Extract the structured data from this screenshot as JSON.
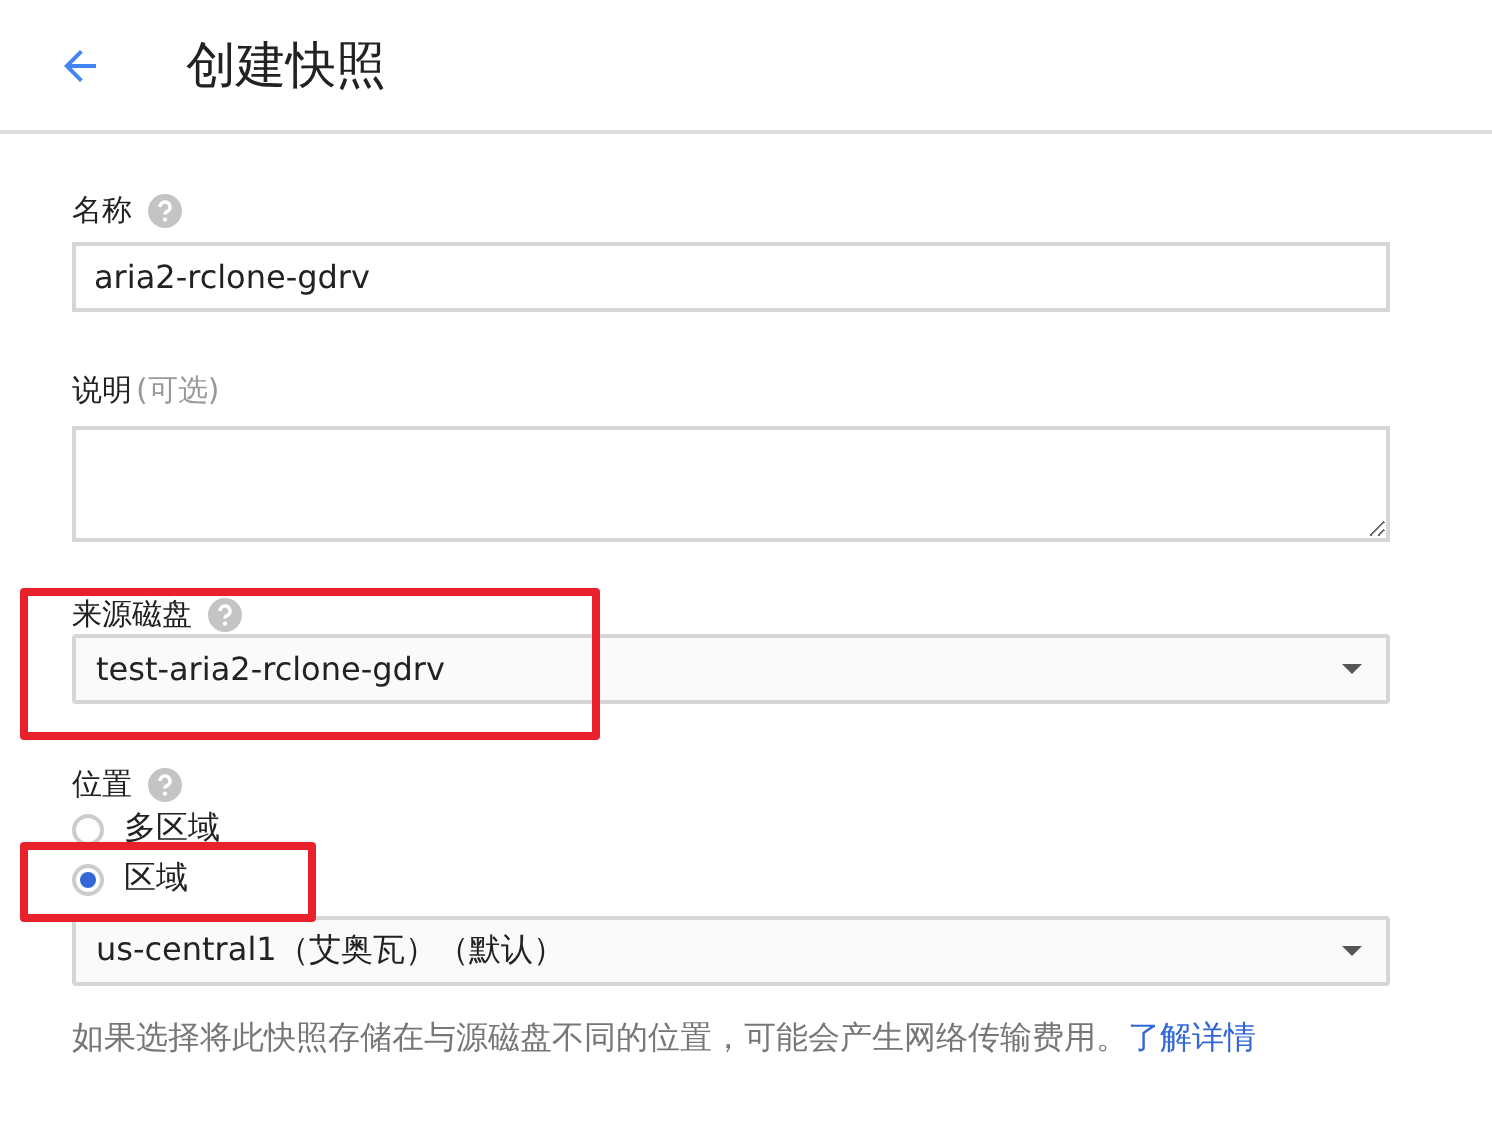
{
  "header": {
    "title": "创建快照"
  },
  "name_field": {
    "label": "名称",
    "value": "aria2-rclone-gdrv"
  },
  "description_field": {
    "label": "说明",
    "optional": "(可选)"
  },
  "source_disk": {
    "label": "来源磁盘",
    "value": "test-aria2-rclone-gdrv",
    "highlighted": true
  },
  "location": {
    "label": "位置",
    "options": [
      {
        "label": "多区域",
        "selected": false,
        "highlighted": false
      },
      {
        "label": "区域",
        "selected": true,
        "highlighted": true
      }
    ],
    "region": "us-central1（艾奥瓦）（默认）",
    "hint": "如果选择将此快照存储在与源磁盘不同的位置，可能会产生网络传输费用。",
    "link": "了解详情"
  }
}
